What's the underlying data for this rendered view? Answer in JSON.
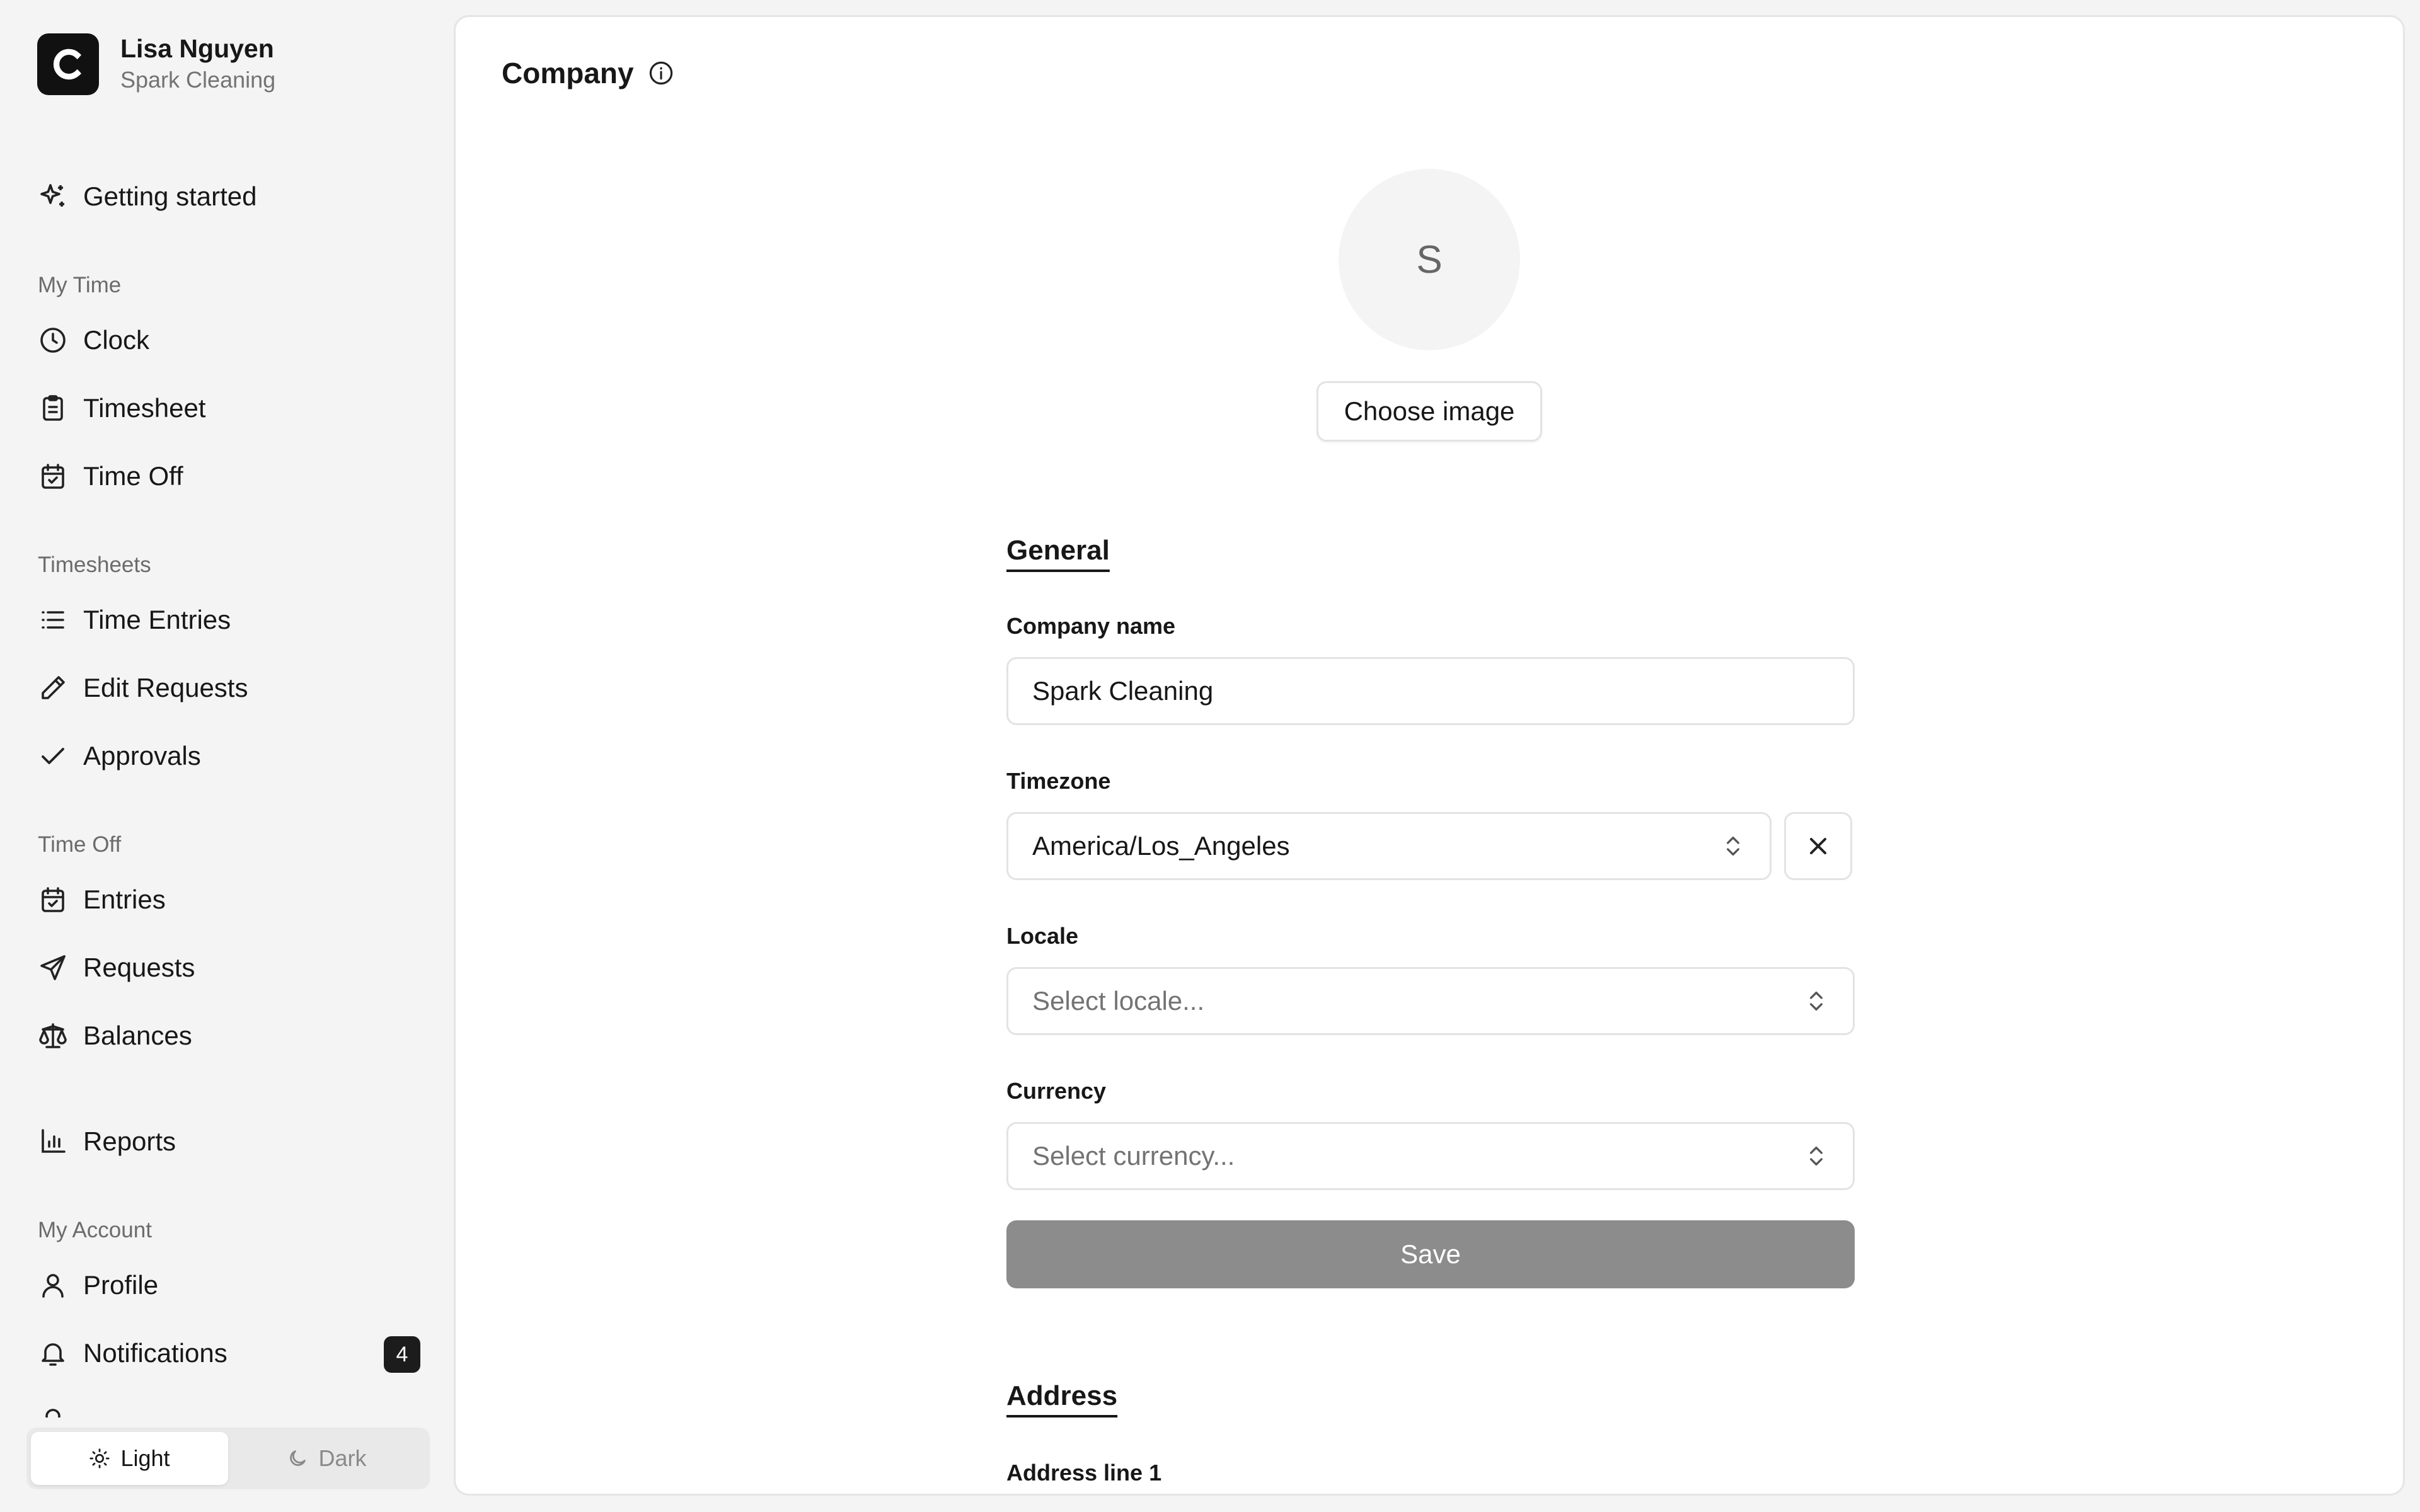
{
  "user": {
    "name": "Lisa Nguyen",
    "company": "Spark Cleaning"
  },
  "nav": {
    "getting_started": "Getting started",
    "my_time": {
      "label": "My Time",
      "clock": "Clock",
      "timesheet": "Timesheet",
      "time_off": "Time Off"
    },
    "timesheets": {
      "label": "Timesheets",
      "time_entries": "Time Entries",
      "edit_requests": "Edit Requests",
      "approvals": "Approvals"
    },
    "time_off": {
      "label": "Time Off",
      "entries": "Entries",
      "requests": "Requests",
      "balances": "Balances"
    },
    "reports": "Reports",
    "my_account": {
      "label": "My Account",
      "profile": "Profile",
      "notifications": "Notifications",
      "notifications_count": "4"
    }
  },
  "theme": {
    "light": "Light",
    "dark": "Dark",
    "selected": "Light"
  },
  "page": {
    "title": "Company",
    "avatar_initial": "S",
    "choose_image": "Choose image"
  },
  "general": {
    "heading": "General",
    "company_name_label": "Company name",
    "company_name_value": "Spark Cleaning",
    "timezone_label": "Timezone",
    "timezone_value": "America/Los_Angeles",
    "locale_label": "Locale",
    "locale_placeholder": "Select locale...",
    "currency_label": "Currency",
    "currency_placeholder": "Select currency...",
    "save": "Save"
  },
  "address": {
    "heading": "Address",
    "line1_label": "Address line 1"
  }
}
